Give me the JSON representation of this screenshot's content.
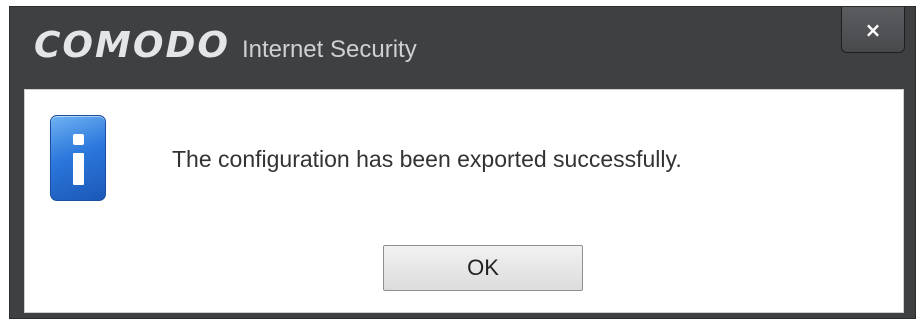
{
  "window": {
    "brand_logo": "COMODO",
    "brand_product": "Internet Security",
    "close_icon": "close-icon",
    "close_glyph": "×"
  },
  "dialog": {
    "icon": "information-icon",
    "message": "The configuration has been exported successfully.",
    "ok_label": "OK"
  },
  "colors": {
    "frame": "#3f4042",
    "content_background": "#ffffff",
    "icon_blue": "#2c78dc"
  }
}
